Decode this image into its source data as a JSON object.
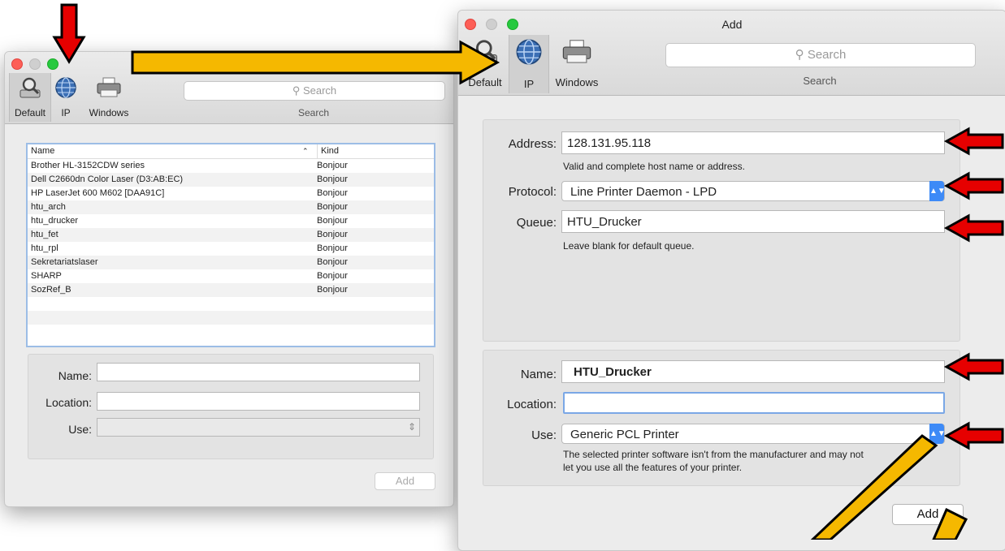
{
  "left_window": {
    "toolbar": {
      "buttons": [
        {
          "label": "Default",
          "icon": "magnifier-printer-icon"
        },
        {
          "label": "IP",
          "icon": "globe-icon"
        },
        {
          "label": "Windows",
          "icon": "printer-icon"
        }
      ],
      "search_placeholder": "Search",
      "search_label": "Search"
    },
    "list": {
      "columns": [
        "Name",
        "Kind"
      ],
      "rows": [
        {
          "name": "Brother HL-3152CDW series",
          "kind": "Bonjour"
        },
        {
          "name": "Dell C2660dn Color Laser (D3:AB:EC)",
          "kind": "Bonjour"
        },
        {
          "name": "HP LaserJet 600 M602 [DAA91C]",
          "kind": "Bonjour"
        },
        {
          "name": "htu_arch",
          "kind": "Bonjour"
        },
        {
          "name": "htu_drucker",
          "kind": "Bonjour"
        },
        {
          "name": "htu_fet",
          "kind": "Bonjour"
        },
        {
          "name": "htu_rpl",
          "kind": "Bonjour"
        },
        {
          "name": "Sekretariatslaser",
          "kind": "Bonjour"
        },
        {
          "name": "SHARP",
          "kind": "Bonjour"
        },
        {
          "name": "SozRef_B",
          "kind": "Bonjour"
        }
      ]
    },
    "form": {
      "name_label": "Name:",
      "location_label": "Location:",
      "use_label": "Use:"
    },
    "add_button": "Add"
  },
  "right_window": {
    "title": "Add",
    "toolbar": {
      "buttons": [
        {
          "label": "Default",
          "icon": "magnifier-printer-icon"
        },
        {
          "label": "IP",
          "icon": "globe-icon"
        },
        {
          "label": "Windows",
          "icon": "printer-icon"
        }
      ],
      "search_placeholder": "Search",
      "search_label": "Search"
    },
    "ip_panel": {
      "address_label": "Address:",
      "address_value": "128.131.95.118",
      "address_hint": "Valid and complete host name or address.",
      "protocol_label": "Protocol:",
      "protocol_value": "Line Printer Daemon - LPD",
      "queue_label": "Queue:",
      "queue_value": "HTU_Drucker",
      "queue_hint": "Leave blank for default queue."
    },
    "printer_panel": {
      "name_label": "Name:",
      "name_value": "HTU_Drucker",
      "location_label": "Location:",
      "location_value": "",
      "use_label": "Use:",
      "use_value": "Generic PCL Printer",
      "use_hint_line1": "The selected printer software isn't from the manufacturer and may not",
      "use_hint_line2": "let you use all the features of your printer."
    },
    "add_button": "Add"
  },
  "colors": {
    "red_arrow": "#e60000",
    "yellow_arrow": "#f5b800",
    "accent_blue": "#3d8af7",
    "focus_ring": "#7aa7e6"
  }
}
